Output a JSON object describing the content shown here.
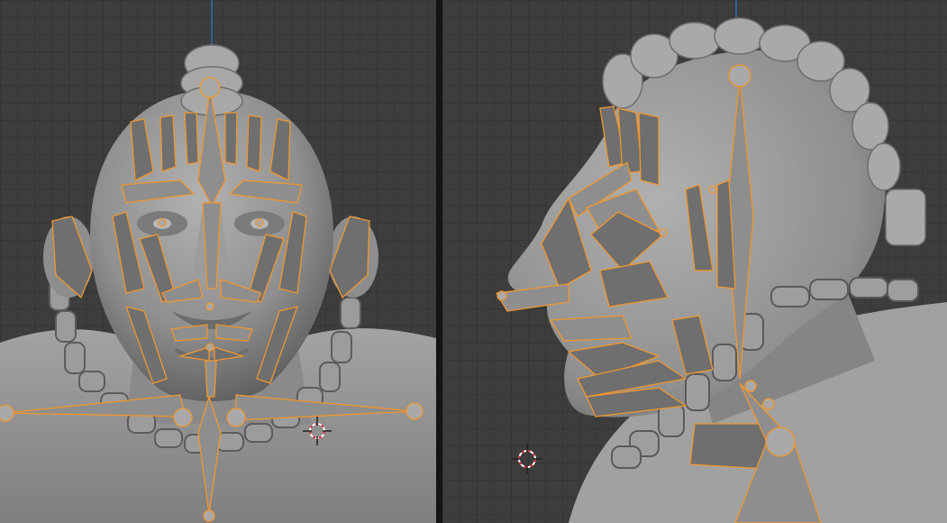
{
  "app": "3D viewport",
  "viewports": [
    {
      "view": "front",
      "object": "character-head",
      "armature_visible": true
    },
    {
      "view": "side",
      "object": "character-head",
      "armature_visible": true
    }
  ],
  "colors": {
    "grid_bg": "#3d3d3d",
    "grid_line": "#353535",
    "bone_outline": "#f0962e",
    "mesh": "#9a9a9a",
    "z_axis": "#2f79d6",
    "cursor_red": "#d9363c"
  },
  "icons": [
    "3d-cursor-icon"
  ]
}
